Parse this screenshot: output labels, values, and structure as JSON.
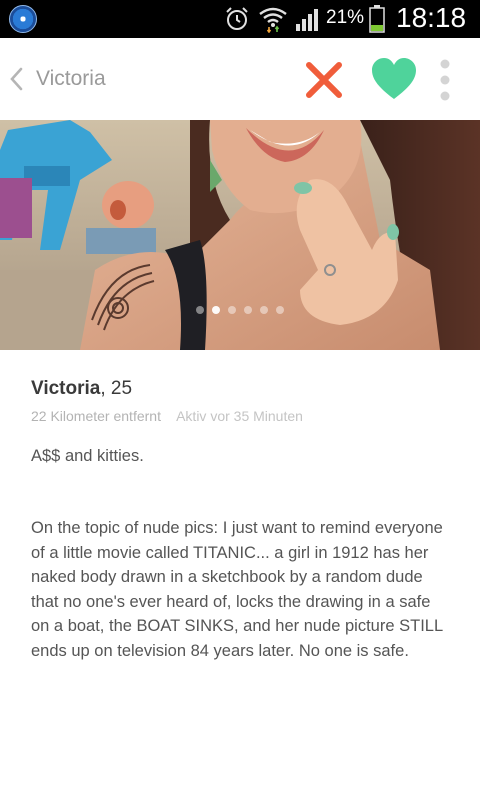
{
  "status_bar": {
    "battery_percent": "21%",
    "time": "18:18",
    "icons": [
      "app-notification-icon",
      "alarm-icon",
      "wifi-icon",
      "signal-icon",
      "battery-icon"
    ]
  },
  "header": {
    "title": "Victoria",
    "icons": [
      "back-chevron-icon",
      "x-icon",
      "heart-icon",
      "more-vertical-icon"
    ],
    "colors": {
      "nope": "#f05d3b",
      "like": "#4fd39b",
      "more": "#d4d4d4"
    }
  },
  "photo": {
    "slide_count": 6,
    "active_slide": 2
  },
  "profile": {
    "name": "Victoria",
    "age_text": ", 25",
    "distance": "22 Kilometer entfernt",
    "active_status": "Aktiv vor 35 Minuten",
    "bio_paragraph_1": "A$$ and kitties.",
    "bio_paragraph_2": "On the topic of nude pics: I just want to remind everyone of a little movie called TITANIC... a girl in 1912 has her naked body drawn in a sketchbook by a random dude that no one's ever heard of, locks the drawing in a safe on a boat, the BOAT SINKS, and her nude picture STILL ends up on television 84 years later. No one is safe."
  }
}
